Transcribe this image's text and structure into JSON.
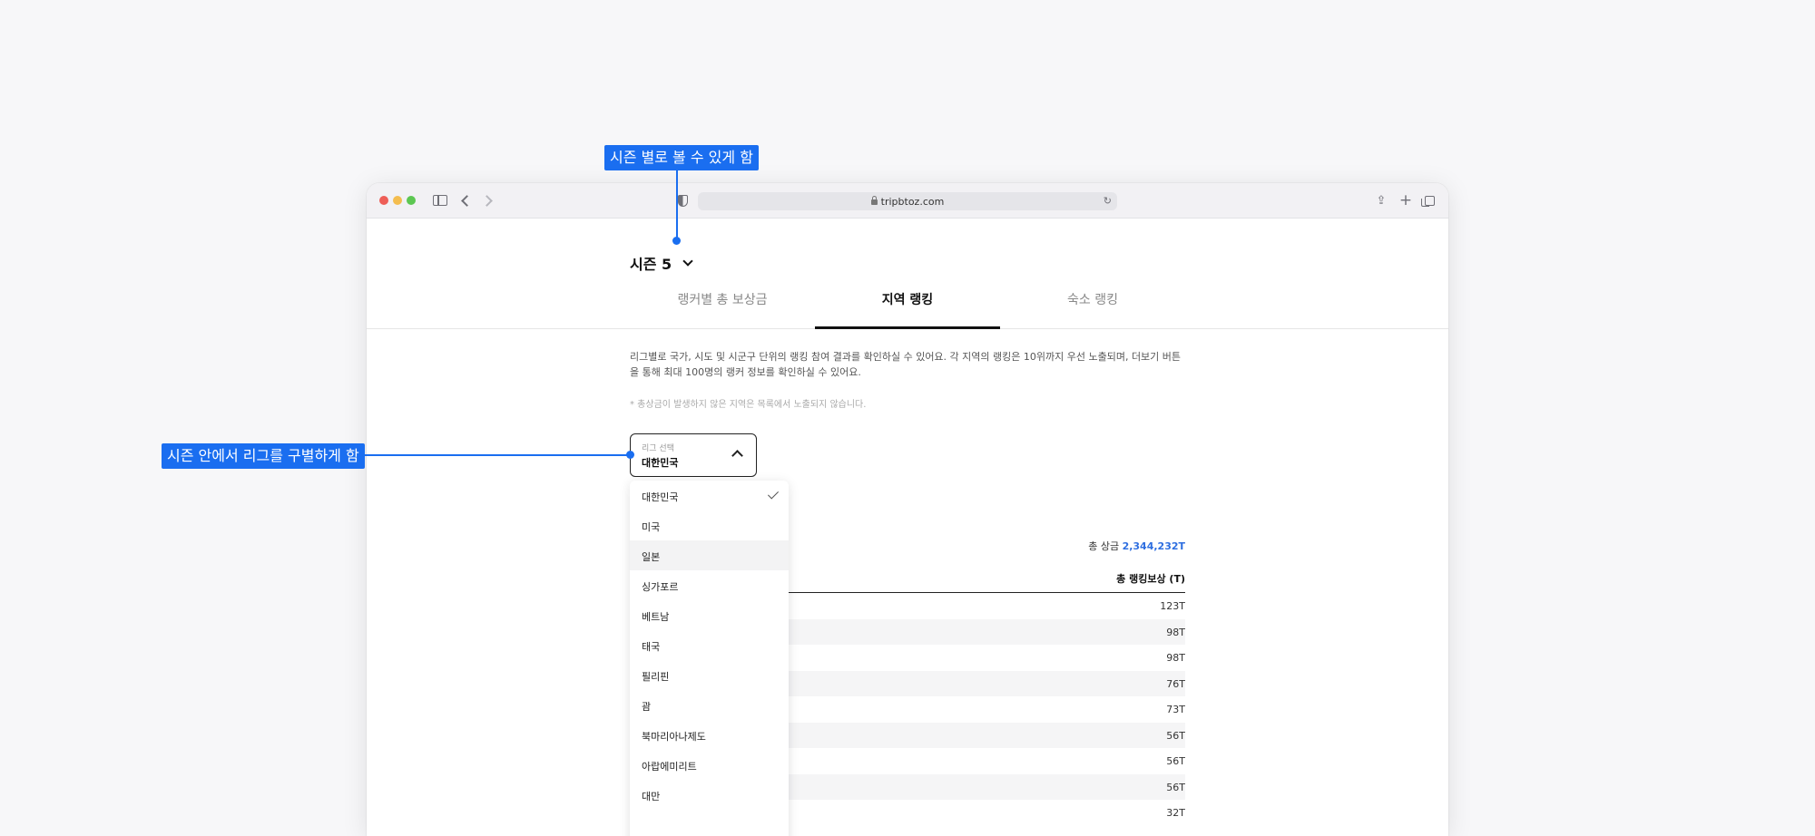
{
  "browser": {
    "url": "tripbtoz.com"
  },
  "page": {
    "season_label": "시즌 5",
    "tabs": [
      {
        "label": "랭커별 총 보상금"
      },
      {
        "label": "지역 랭킹"
      },
      {
        "label": "숙소 랭킹"
      }
    ],
    "description": "리그별로 국가, 시도 및 시군구 단위의 랭킹 참여 결과를 확인하실 수 있어요. 각 지역의 랭킹은 10위까지 우선 노출되며, 더보기 버튼을 통해 최대 100명의 랭커 정보를 확인하실 수 있어요.",
    "note": "* 총상금이 발생하지 않은 지역은 목록에서 노출되지 않습니다.",
    "league_select": {
      "label": "리그 선택",
      "value": "대한민국"
    },
    "league_options": [
      {
        "label": "대한민국",
        "selected": true
      },
      {
        "label": "미국"
      },
      {
        "label": "일본",
        "hover": true
      },
      {
        "label": "싱가포르"
      },
      {
        "label": "베트남"
      },
      {
        "label": "태국"
      },
      {
        "label": "필리핀"
      },
      {
        "label": "괌"
      },
      {
        "label": "북마리아나제도"
      },
      {
        "label": "아랍에미리트"
      },
      {
        "label": "대만"
      }
    ],
    "total_prize_label": "총 상금",
    "total_prize_value": "2,344,232T",
    "column_header": "총 랭킹보상 (T)",
    "reward_values": [
      "123T",
      "98T",
      "98T",
      "76T",
      "73T",
      "56T",
      "56T",
      "56T",
      "32T"
    ]
  },
  "annotations": {
    "season": "시즌 별로 볼 수 있게 함",
    "league": "시즌 안에서 리그를 구별하게 함"
  },
  "colors": {
    "annotation": "#1a6ef0",
    "prize_accent": "#2f6fe0"
  }
}
